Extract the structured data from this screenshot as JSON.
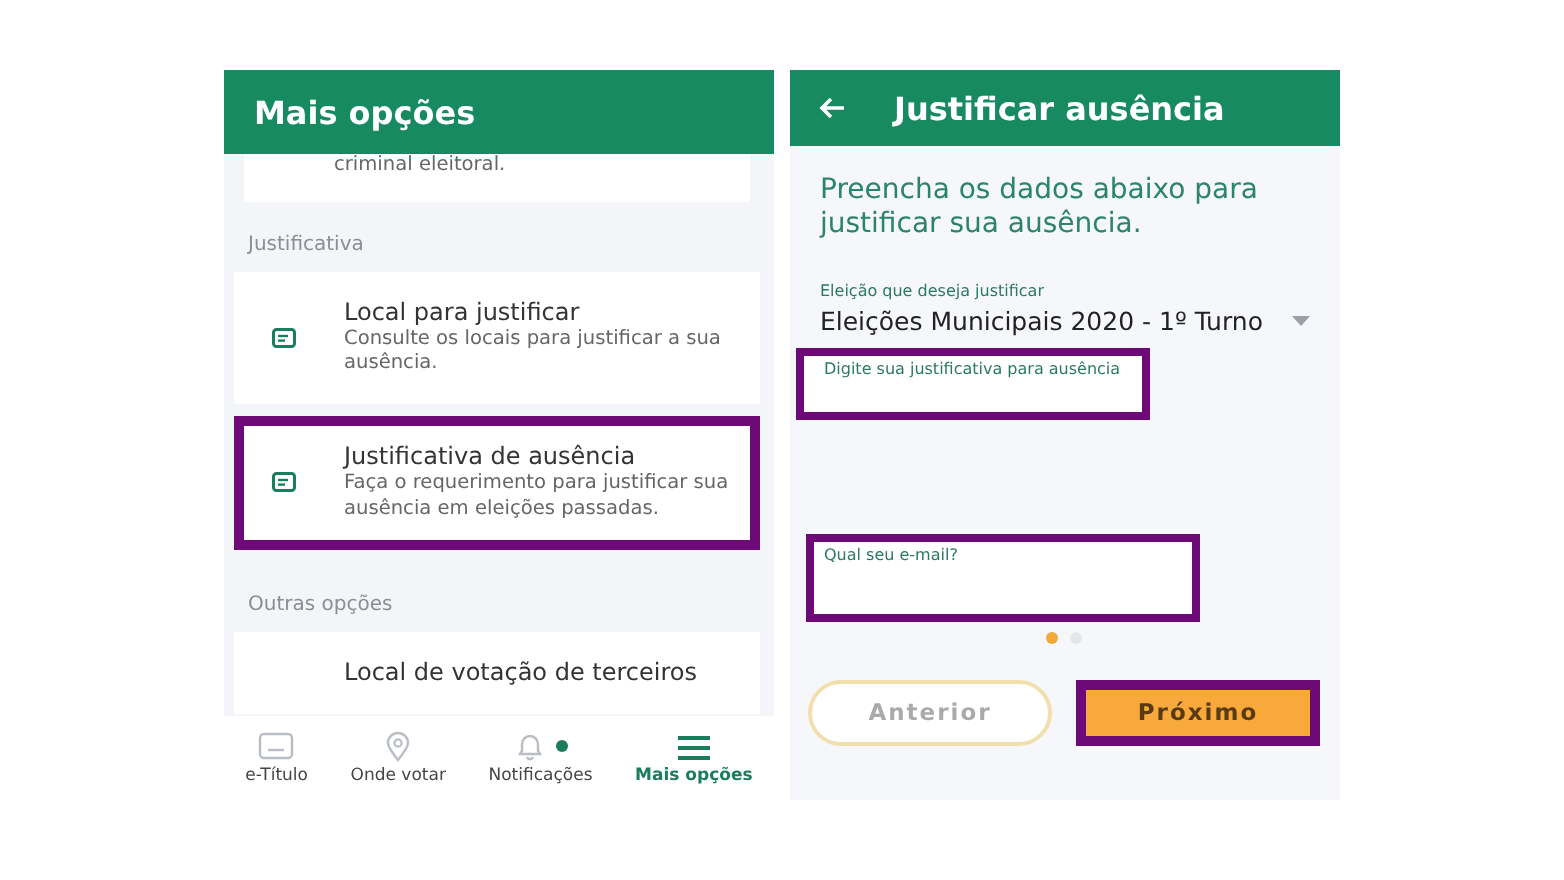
{
  "left_screen": {
    "title": "Mais opções",
    "partial_card": {
      "description": "criminal eleitoral."
    },
    "sections": [
      {
        "heading": "Justificativa",
        "items": [
          {
            "title": "Local para justificar",
            "description": "Consulte os locais para justificar a sua ausência.",
            "highlighted": false
          },
          {
            "title": "Justificativa de ausência",
            "description": "Faça o requerimento para justificar sua ausência em eleições passadas.",
            "highlighted": true
          }
        ]
      },
      {
        "heading": "Outras opções",
        "items": [
          {
            "title": "Local de votação de terceiros",
            "highlighted": false
          }
        ]
      }
    ],
    "bottom_nav": [
      {
        "kind": "card",
        "label": "e-Título",
        "selected": false,
        "badge": false
      },
      {
        "kind": "pin",
        "label": "Onde votar",
        "selected": false,
        "badge": false
      },
      {
        "kind": "bell",
        "label": "Notificações",
        "selected": false,
        "badge": true
      },
      {
        "kind": "menu",
        "label": "Mais opções",
        "selected": true,
        "badge": false
      }
    ]
  },
  "right_screen": {
    "title": "Justificar ausência",
    "intro": "Preencha os dados abaixo para justificar sua ausência.",
    "fields": [
      {
        "kind": "select",
        "label": "Eleição que deseja justificar",
        "value": "Eleições Municipais 2020 - 1º Turno",
        "highlighted": false
      },
      {
        "kind": "text",
        "label": "Digite sua justificativa para ausência",
        "highlighted": true
      },
      {
        "kind": "text",
        "label": "Qual seu e-mail?",
        "highlighted": true
      }
    ],
    "page_dots": [
      {
        "selected": true
      },
      {
        "selected": false
      }
    ],
    "buttons": [
      {
        "kind": "outline",
        "label": "Anterior",
        "highlighted": false
      },
      {
        "kind": "primary",
        "label": "Próximo",
        "highlighted": true
      }
    ]
  }
}
